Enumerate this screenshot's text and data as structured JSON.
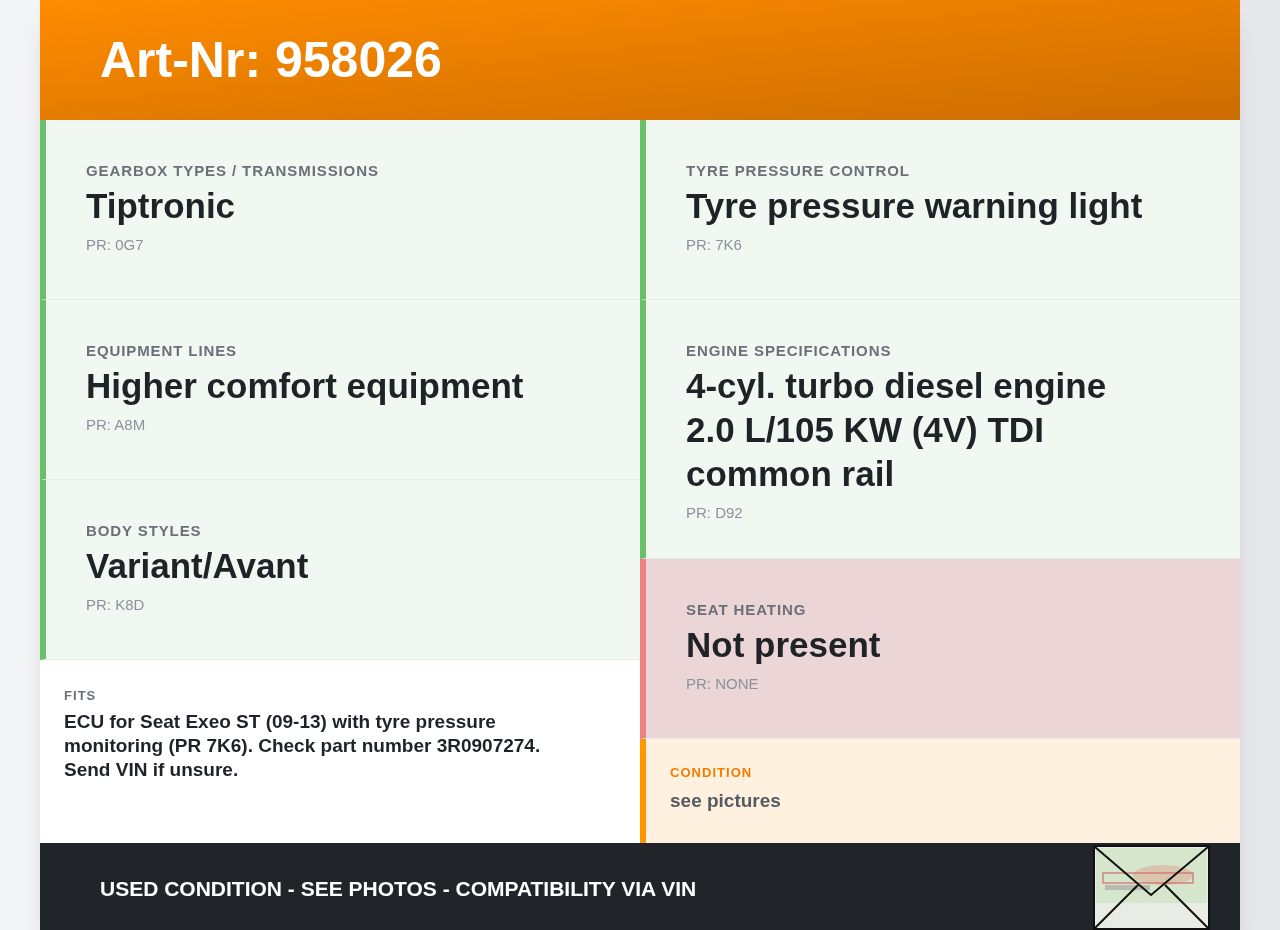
{
  "header": {
    "title": "Art-Nr: 958026"
  },
  "left_features": [
    {
      "label": "GEARBOX TYPES / TRANSMISSIONS",
      "value": "Tiptronic",
      "code": "PR: 0G7",
      "present": true
    },
    {
      "label": "EQUIPMENT LINES",
      "value": "Higher comfort equipment",
      "code": "PR: A8M",
      "present": true
    },
    {
      "label": "BODY STYLES",
      "value": "Variant/Avant",
      "code": "PR: K8D",
      "present": true
    }
  ],
  "fits": {
    "label": "FITS",
    "text": "ECU for Seat Exeo ST (09-13) with tyre pressure monitoring (PR 7K6). Check part number 3R0907274. Send VIN if unsure."
  },
  "right_features": [
    {
      "label": "TYRE PRESSURE CONTROL",
      "value": "Tyre pressure warning light",
      "code": "PR: 7K6",
      "present": true
    },
    {
      "label": "ENGINE SPECIFICATIONS",
      "value": "4-cyl. turbo diesel engine 2.0 L/105 KW (4V) TDI common rail",
      "code": "PR: D92",
      "present": true
    },
    {
      "label": "SEAT HEATING",
      "value": "Not present",
      "code": "PR: NONE",
      "present": false
    }
  ],
  "condition": {
    "label": "CONDITION",
    "value": "see pictures"
  },
  "footer": {
    "text": "USED CONDITION - SEE PHOTOS - COMPATIBILITY VIA VIN"
  }
}
